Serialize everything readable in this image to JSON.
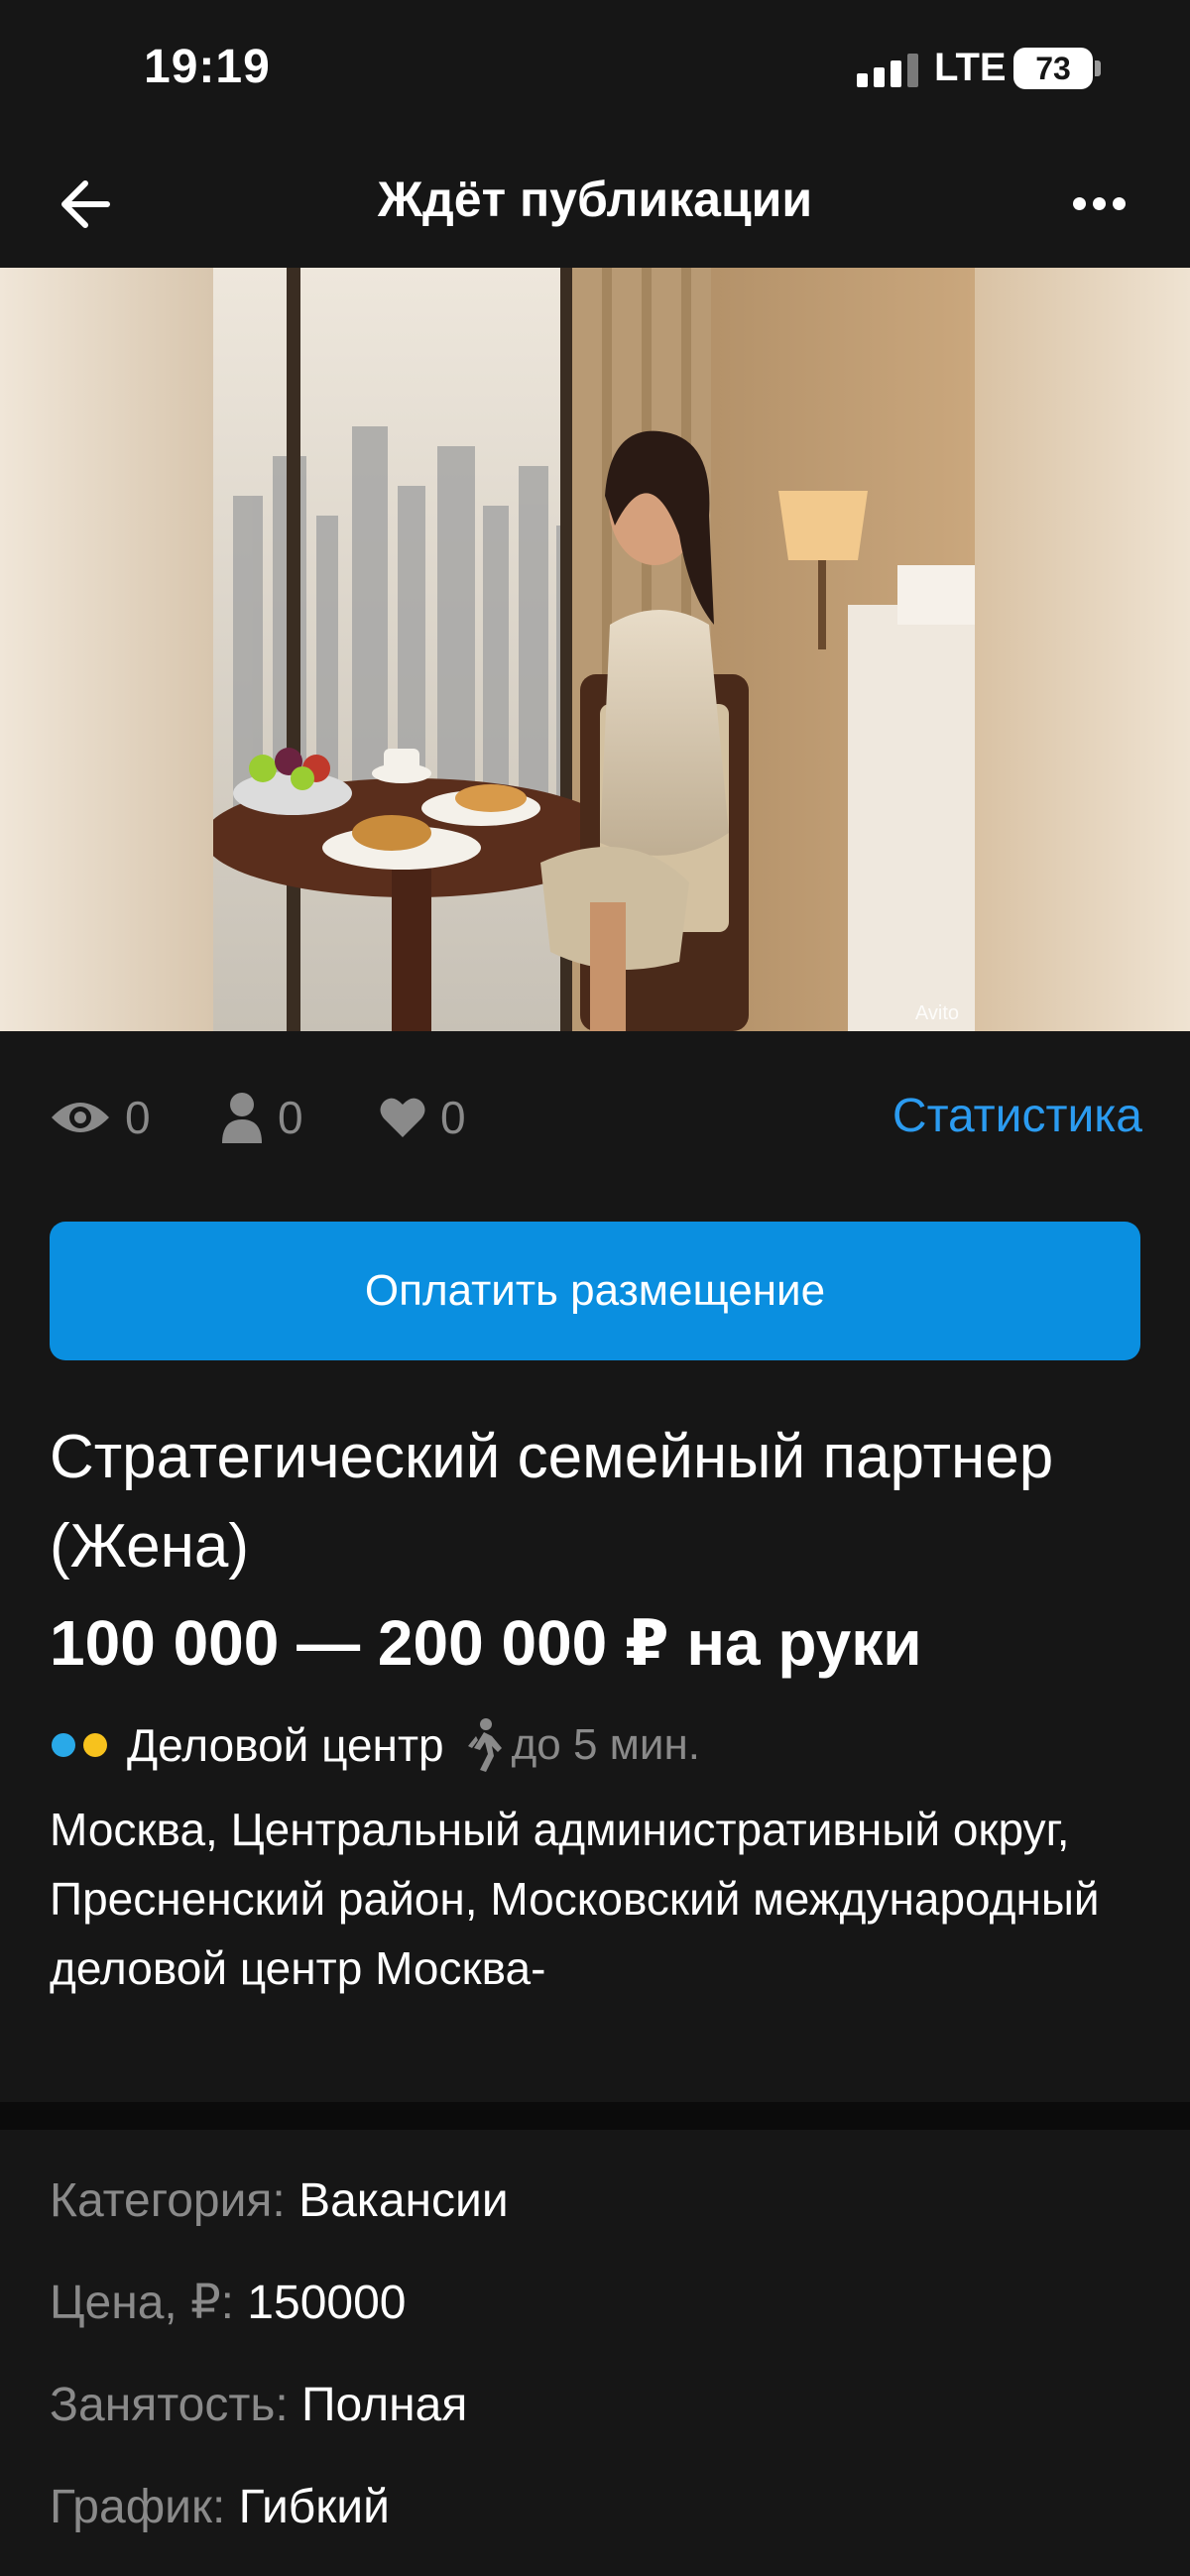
{
  "status_bar": {
    "time": "19:19",
    "network": "LTE",
    "battery": "73"
  },
  "header": {
    "title": "Ждёт публикации",
    "back_icon": "arrow-left-icon",
    "more_icon": "more-dots-icon"
  },
  "photo": {
    "watermark": "Avito"
  },
  "stats": {
    "views": "0",
    "contacts": "0",
    "favorites": "0",
    "link_label": "Статистика"
  },
  "pay_button": {
    "label": "Оплатить размещение"
  },
  "listing": {
    "title": "Стратегический семейный партнер (Жена)",
    "price": "100 000 — 200 000 ₽ на руки",
    "metro": {
      "station": "Деловой центр",
      "walk_time": "до 5 мин.",
      "line_colors": [
        "#29a9e8",
        "#f7c21d"
      ]
    },
    "address": "Москва, Центральный административный округ, Пресненский район, Московский международный деловой центр Москва-"
  },
  "params": [
    {
      "key": "Категория:",
      "value": "Вакансии"
    },
    {
      "key": "Цена, ₽:",
      "value": "150000"
    },
    {
      "key": "Занятость:",
      "value": "Полная"
    },
    {
      "key": "График:",
      "value": "Гибкий"
    }
  ],
  "colors": {
    "background": "#161616",
    "accent": "#0a8fe0",
    "link": "#2b9bf0",
    "muted": "#8a8a8a"
  }
}
